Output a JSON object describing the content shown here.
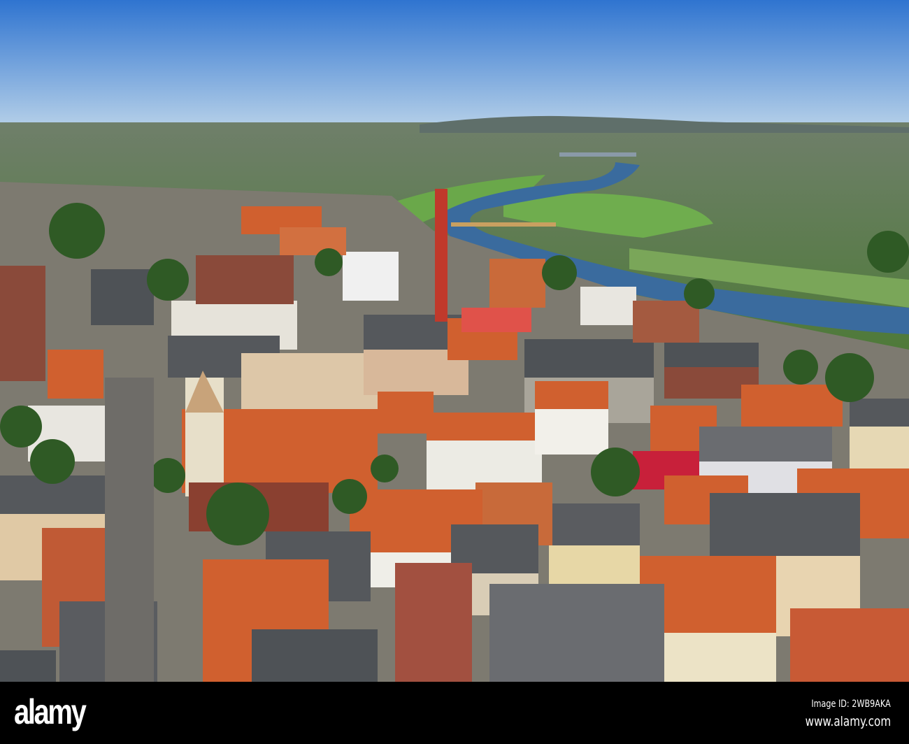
{
  "photo": {
    "subject": "Aerial view of town with river",
    "watermark": "alamy"
  },
  "footer": {
    "logo": "alamy",
    "image_id": "Image ID: 2WB9AKA",
    "url": "www.alamy.com"
  },
  "colors": {
    "sky_top": "#2f74d0",
    "sky_horizon": "#b4cfe8",
    "river": "#3a6b9e",
    "roof_orange": "#d0602f",
    "roof_gray": "#55585c"
  }
}
